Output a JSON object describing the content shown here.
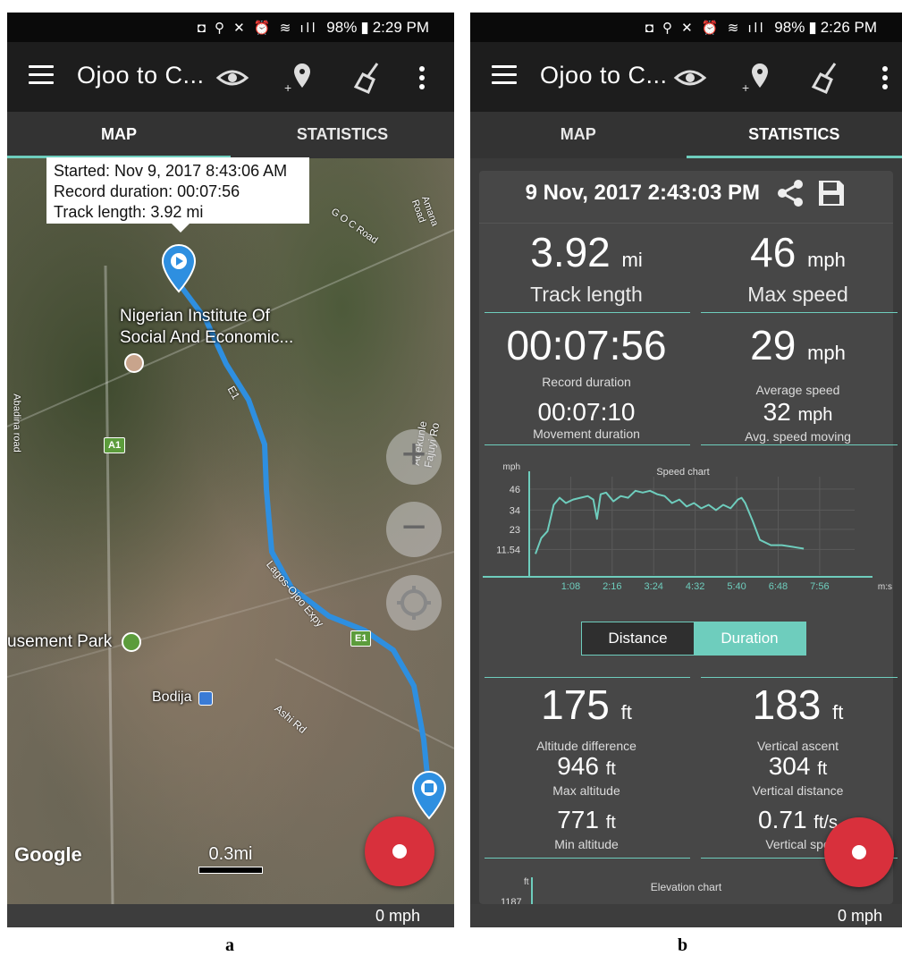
{
  "left": {
    "status": {
      "battery": "98%",
      "time": "2:29 PM"
    },
    "appbar": {
      "title": "Ojoo to C..."
    },
    "tabs": [
      {
        "label": "MAP"
      },
      {
        "label": "STATISTICS"
      }
    ],
    "infobox": {
      "started": "Started: Nov 9, 2017 8:43:06 AM",
      "duration": "Record duration: 00:07:56",
      "length": "Track length: 3.92 mi"
    },
    "labels": {
      "institute_1": "Nigerian Institute Of",
      "institute_2": "Social And Economic...",
      "amusement": "usement Park",
      "bodija": "Bodija",
      "ashi": "Ashi Rd",
      "lagos": "Lagos-Ojoo Expy",
      "e1a": "E1",
      "e1b": "E1",
      "a1": "A1",
      "goc": "G O C Road",
      "amana": "Amana Road",
      "abadina": "Abadina road",
      "fajuyi": "Adekunle Fajuyi Ro"
    },
    "google": "Google",
    "scale": "0.3mi",
    "bottom_speed": "0 mph"
  },
  "right": {
    "status": {
      "battery": "98%",
      "time": "2:26 PM"
    },
    "appbar": {
      "title": "Ojoo to C..."
    },
    "tabs": [
      {
        "label": "MAP"
      },
      {
        "label": "STATISTICS"
      }
    ],
    "date": "9 Nov, 2017 2:43:03 PM",
    "stats": {
      "track_length": {
        "value": "3.92",
        "unit": "mi",
        "label": "Track length"
      },
      "max_speed": {
        "value": "46",
        "unit": "mph",
        "label": "Max speed"
      },
      "record_duration": {
        "value": "00:07:56",
        "label": "Record duration"
      },
      "avg_speed": {
        "value": "29",
        "unit": "mph",
        "label": "Average speed"
      },
      "movement_duration": {
        "value": "00:07:10",
        "label": "Movement duration"
      },
      "avg_speed_moving": {
        "value": "32",
        "unit": "mph",
        "label": "Avg. speed moving"
      },
      "altitude_difference": {
        "value": "175",
        "unit": "ft",
        "label": "Altitude difference"
      },
      "vertical_ascent": {
        "value": "183",
        "unit": "ft",
        "label": "Vertical ascent"
      },
      "max_altitude": {
        "value": "946",
        "unit": "ft",
        "label": "Max altitude"
      },
      "vertical_distance": {
        "value": "304",
        "unit": "ft",
        "label": "Vertical distance"
      },
      "min_altitude": {
        "value": "771",
        "unit": "ft",
        "label": "Min altitude"
      },
      "vertical_speed": {
        "value": "0.71",
        "unit": "ft/s",
        "label": "Vertical spe"
      }
    },
    "toggle": {
      "distance": "Distance",
      "duration": "Duration"
    },
    "elevation": {
      "title": "Elevation chart",
      "yunit": "ft",
      "ytick": "1187"
    },
    "bottom_speed": "0 mph"
  },
  "captions": {
    "a": "a",
    "b": "b"
  },
  "colors": {
    "accent": "#6ecdbd",
    "record": "#d8303c",
    "route": "#2e8fe0"
  },
  "chart_data": {
    "type": "line",
    "title": "Speed chart",
    "ylabel": "mph",
    "xlabel": "m:s",
    "yticks": [
      11.54,
      23,
      34,
      46
    ],
    "xticks": [
      "1:08",
      "2:16",
      "3:24",
      "4:32",
      "5:40",
      "6:48",
      "7:56"
    ],
    "ylim": [
      0,
      50
    ],
    "xlim": [
      0,
      8.4
    ],
    "x": [
      0.17,
      0.33,
      0.5,
      0.67,
      0.83,
      1.0,
      1.2,
      1.4,
      1.6,
      1.75,
      1.85,
      1.95,
      2.1,
      2.3,
      2.5,
      2.7,
      2.9,
      3.1,
      3.3,
      3.5,
      3.7,
      3.9,
      4.1,
      4.3,
      4.5,
      4.7,
      4.9,
      5.1,
      5.3,
      5.5,
      5.7,
      5.8,
      5.9,
      6.1,
      6.3,
      6.6,
      6.9,
      7.2,
      7.5
    ],
    "series": [
      {
        "values": [
          9,
          18,
          22,
          37,
          41,
          38,
          40,
          41,
          42,
          40,
          29,
          43,
          44,
          39,
          42,
          41,
          45,
          44,
          45,
          43,
          42,
          38,
          40,
          36,
          38,
          35,
          37,
          34,
          37,
          35,
          40,
          41,
          38,
          28,
          17,
          14,
          14,
          13,
          12
        ]
      }
    ]
  }
}
